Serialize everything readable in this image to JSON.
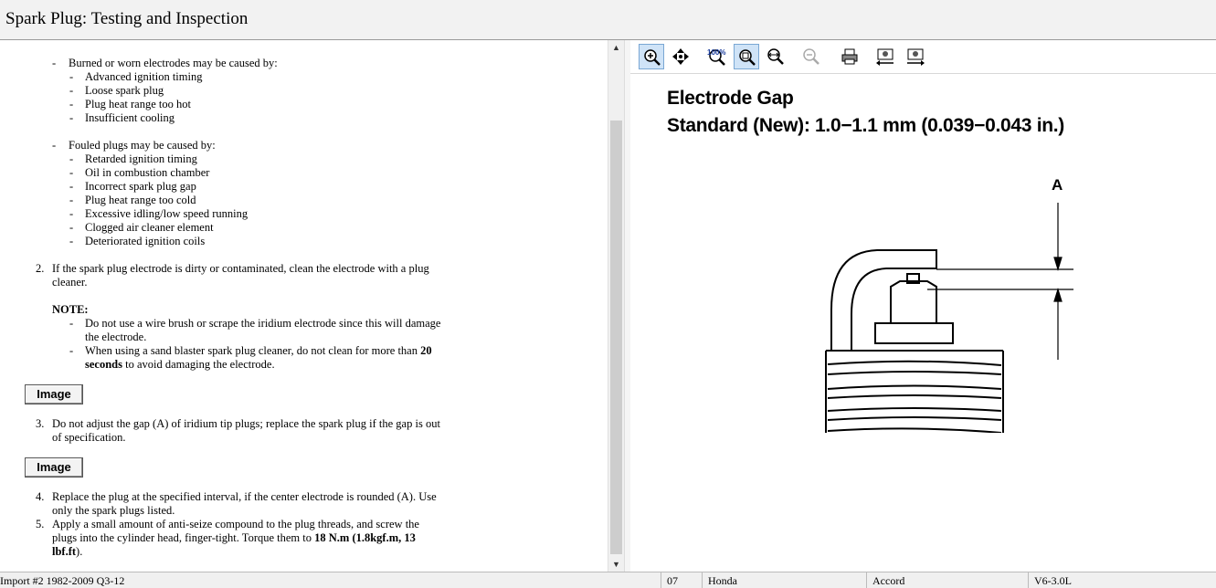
{
  "window": {
    "title": "Spark Plug:  Testing and Inspection"
  },
  "left": {
    "list_burned": {
      "header": "Burned or worn electrodes may be caused by:",
      "items": [
        "Advanced ignition timing",
        "Loose spark plug",
        "Plug heat range too hot",
        "Insufficient cooling"
      ]
    },
    "list_fouled": {
      "header": "Fouled plugs may be caused by:",
      "items": [
        "Retarded ignition timing",
        "Oil in combustion chamber",
        "Incorrect spark plug gap",
        "Plug heat range too cold",
        "Excessive idling/low speed running",
        "Clogged air cleaner element",
        "Deteriorated ignition coils"
      ]
    },
    "step2": {
      "num": "2.",
      "line1": "If the spark plug electrode is dirty or contaminated, clean the electrode with a plug",
      "line2": "cleaner."
    },
    "note": {
      "label": "NOTE:",
      "item1_line1": "Do not use a wire brush or scrape the iridium electrode since this will damage",
      "item1_line2": "the electrode.",
      "item2_line1_a": "When using a sand blaster spark plug cleaner, do not clean for more than ",
      "item2_line1_b": "20",
      "item2_line2_a": "seconds",
      "item2_line2_b": " to avoid damaging the electrode."
    },
    "image_button_1": "Image",
    "step3": {
      "num": "3.",
      "line1": "Do not adjust the gap (A) of iridium tip plugs; replace the spark plug if the gap is out",
      "line2": "of specification."
    },
    "image_button_2": "Image",
    "step4": {
      "num": "4.",
      "line1": "Replace the plug at the specified interval, if the center electrode is rounded (A). Use",
      "line2": "only the spark plugs listed."
    },
    "step5": {
      "num": "5.",
      "line1": "Apply a small amount of anti-seize compound to the plug threads, and screw the",
      "line2_a": "plugs into the cylinder head, finger-tight. Torque them to ",
      "line2_b": "18 N.m (1.8kgf.m, 13",
      "line3_b": "lbf.ft",
      "line3_c": ")."
    }
  },
  "right": {
    "toolbar": {
      "buttons": [
        "zoom-in",
        "pan",
        "actual-size",
        "zoom-window",
        "fit-width",
        "zoom-out",
        "print",
        "prev-image",
        "next-image"
      ],
      "zoom_label": "100%"
    },
    "figure": {
      "heading": "Electrode Gap",
      "spec": "Standard (New): 1.0−1.1 mm (0.039−0.043 in.)",
      "label": "A"
    }
  },
  "statusbar": {
    "source": "Import #2 1982-2009 Q3-12",
    "year": "07",
    "make": "Honda",
    "model": "Accord",
    "engine": "V6-3.0L"
  }
}
